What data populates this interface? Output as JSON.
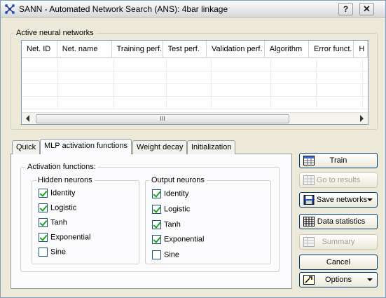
{
  "window": {
    "title": "SANN - Automated Network Search (ANS): 4bar linkage",
    "help_label": "?",
    "close_label": "✕"
  },
  "networks": {
    "group_label": "Active neural networks",
    "columns": [
      "Net. ID",
      "Net. name",
      "Training perf.",
      "Test perf.",
      "Validation perf.",
      "Algorithm",
      "Error funct.",
      "H"
    ],
    "scroll_thumb_label": "III"
  },
  "tabs": [
    "Quick",
    "MLP activation functions",
    "Weight decay",
    "Initialization"
  ],
  "active_tab": "MLP activation functions",
  "activation": {
    "group_label": "Activation functions:",
    "hidden": {
      "label": "Hidden neurons",
      "items": [
        {
          "label": "Identity",
          "checked": true
        },
        {
          "label": "Logistic",
          "checked": true
        },
        {
          "label": "Tanh",
          "checked": true
        },
        {
          "label": "Exponential",
          "checked": true
        },
        {
          "label": "Sine",
          "checked": false
        }
      ]
    },
    "output": {
      "label": "Output neurons",
      "items": [
        {
          "label": "Identity",
          "checked": true
        },
        {
          "label": "Logistic",
          "checked": true
        },
        {
          "label": "Tanh",
          "checked": true
        },
        {
          "label": "Exponential",
          "checked": true
        },
        {
          "label": "Sine",
          "checked": false
        }
      ]
    }
  },
  "buttons": {
    "train": "Train",
    "go_to_results": "Go to results",
    "save_networks": "Save networks",
    "data_statistics": "Data statistics",
    "summary": "Summary",
    "cancel": "Cancel",
    "options": "Options"
  }
}
